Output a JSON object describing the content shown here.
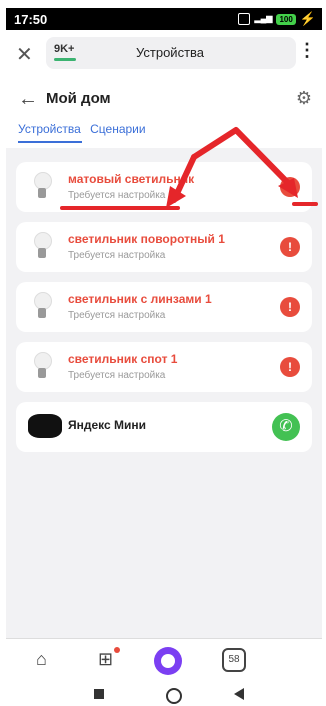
{
  "status": {
    "time": "17:50",
    "battery": "100"
  },
  "topbar": {
    "badge": "9K+",
    "title": "Устройства"
  },
  "page": {
    "title": "Мой дом"
  },
  "tabs": [
    {
      "label": "Устройства"
    },
    {
      "label": "Сценарии"
    }
  ],
  "devices": [
    {
      "name": "матовый светильник",
      "status": "Требуется настройка"
    },
    {
      "name": "светильник поворотный 1",
      "status": "Требуется настройка"
    },
    {
      "name": "светильник с линзами 1",
      "status": "Требуется настройка"
    },
    {
      "name": "светильник спот 1",
      "status": "Требуется настройка"
    }
  ],
  "mini": {
    "name": "Яндекс Мини"
  },
  "bottom": {
    "badge": "58"
  },
  "colors": {
    "accent": "#3b6fd8",
    "error": "#e84c3d",
    "call": "#43c153",
    "alisa": "#7b3ff2"
  }
}
